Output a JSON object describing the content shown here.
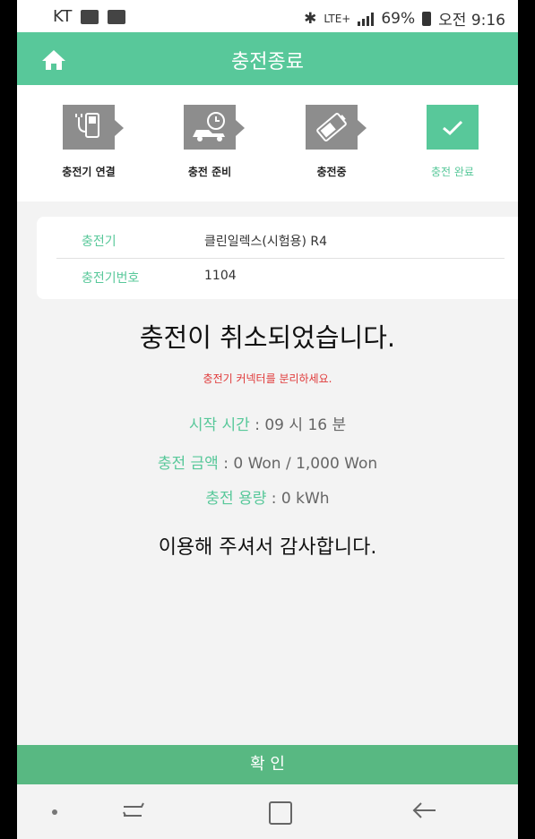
{
  "status_bar": {
    "carrier": "KT",
    "network": "LTE+",
    "battery": "69%",
    "time": "오전 9:16"
  },
  "header": {
    "title": "충전종료"
  },
  "steps": [
    {
      "label": "충전기 연결",
      "icon": "charger-plug-icon",
      "active": false
    },
    {
      "label": "충전 준비",
      "icon": "car-clock-icon",
      "active": false
    },
    {
      "label": "충전중",
      "icon": "battery-charging-icon",
      "active": false
    },
    {
      "label": "충전 완료",
      "icon": "checkmark-icon",
      "active": true
    }
  ],
  "info": {
    "charger_label": "충전기",
    "charger_value": "클린일렉스(시험용) R4",
    "number_label": "충전기번호",
    "number_value": "1104"
  },
  "message": "충전이 취소되었습니다.",
  "warning": "충전기 커넥터를 분리하세요.",
  "details": {
    "start_label": "시작 시간",
    "start_value": " : 09 시 16 분",
    "amount_label": "충전 금액",
    "amount_value": " : 0 Won / 1,000 Won",
    "capacity_label": "충전 용량",
    "capacity_value": " : 0 kWh"
  },
  "thanks": "이용해 주셔서 감사합니다.",
  "confirm_label": "확 인",
  "colors": {
    "accent": "#58c89a",
    "confirm": "#58b882",
    "warning": "#e03a3a",
    "step_inactive": "#8d8d8d"
  }
}
